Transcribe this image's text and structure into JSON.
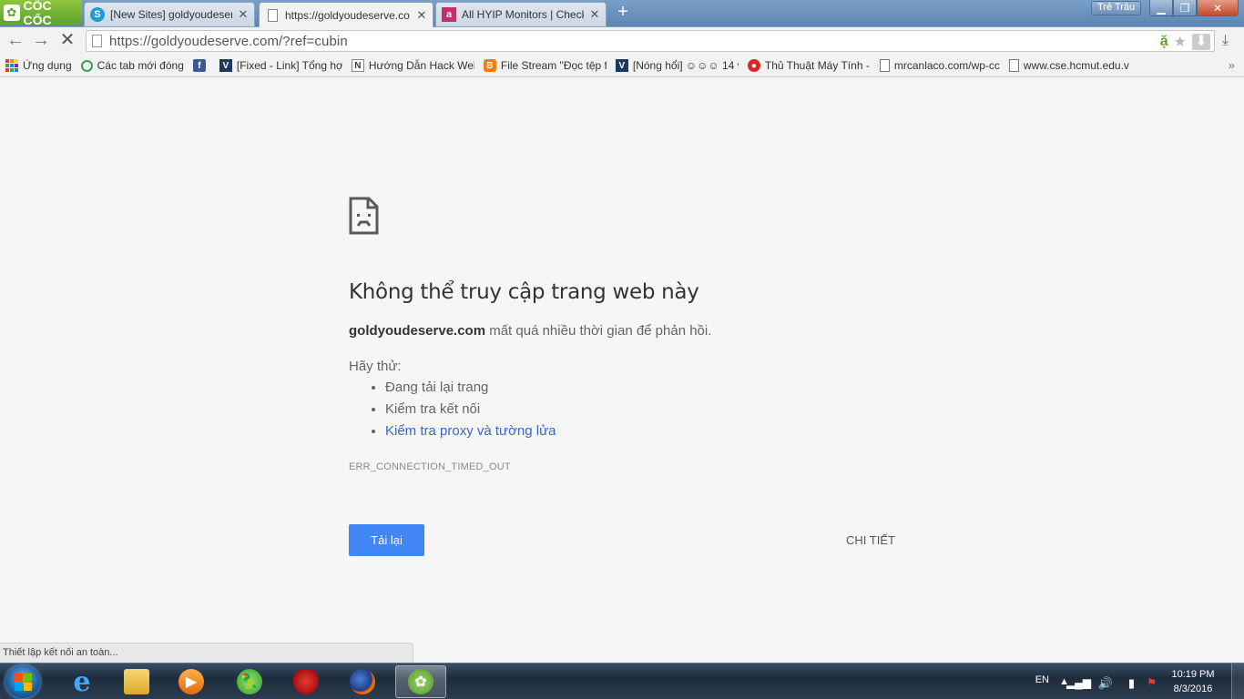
{
  "browser": {
    "logo_text": "CỐC CỐC",
    "tabs": [
      {
        "title": "[New Sites] goldyoudeserv",
        "icon": "skype-icon"
      },
      {
        "title": "https://goldyoudeserve.co",
        "icon": "page-icon",
        "active": true
      },
      {
        "title": "All HYIP Monitors | Check",
        "icon": "a-icon"
      }
    ],
    "user_name": "Trẻ Trâu",
    "address": {
      "url": "https://goldyoudeserve.com/?ref=cubin"
    }
  },
  "bookmarks": [
    {
      "label": "Ứng dụng",
      "icon": "apps-icon"
    },
    {
      "label": "Các tab mới đóng",
      "icon": "history-icon"
    },
    {
      "label": "",
      "icon": "facebook-icon"
    },
    {
      "label": "[Fixed - Link] Tổng hợ",
      "icon": "v-icon"
    },
    {
      "label": "Hướng Dẫn Hack Wel",
      "icon": "n-icon"
    },
    {
      "label": "File Stream \"Đọc tệp f",
      "icon": "blogger-icon"
    },
    {
      "label": "[Nóng hổi] ☺☺☺ 14 v",
      "icon": "v-icon"
    },
    {
      "label": "Thủ Thuật Máy Tính -",
      "icon": "red-icon"
    },
    {
      "label": "mrcanlaco.com/wp-cc",
      "icon": "doc-icon"
    },
    {
      "label": "www.cse.hcmut.edu.v",
      "icon": "doc-icon"
    }
  ],
  "error": {
    "title": "Không thể truy cập trang web này",
    "host": "goldyoudeserve.com",
    "desc_rest": " mất quá nhiều thời gian để phản hồi.",
    "try_label": "Hãy thử:",
    "suggestions": [
      {
        "text": "Đang tải lại trang",
        "link": false
      },
      {
        "text": "Kiểm tra kết nối",
        "link": false
      },
      {
        "text": "Kiểm tra proxy và tường lửa",
        "link": true
      }
    ],
    "code": "ERR_CONNECTION_TIMED_OUT",
    "reload_label": "Tải lại",
    "details_label": "CHI TIẾT"
  },
  "status_bar": "Thiết lập kết nối an toàn...",
  "taskbar": {
    "apps": [
      "ie-icon",
      "explorer-icon",
      "media-player-icon",
      "parrot-icon",
      "bag-icon",
      "firefox-icon",
      "coccoc-icon"
    ],
    "language": "EN",
    "time": "10:19 PM",
    "date": "8/3/2016"
  },
  "colors": {
    "accent": "#4285f4",
    "link": "#3367d6",
    "coccoc_green": "#5da12e"
  }
}
